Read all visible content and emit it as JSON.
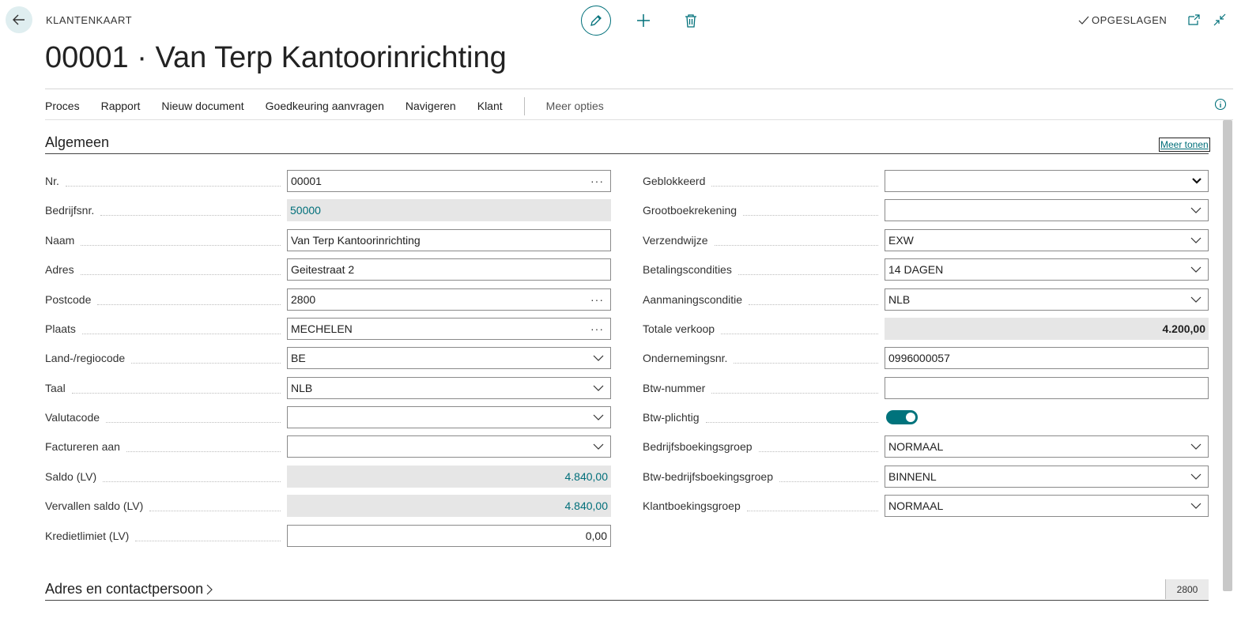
{
  "header": {
    "page_type": "KLANTENKAART",
    "title": "00001 · Van Terp Kantoorinrichting",
    "saved_status": "OPGESLAGEN"
  },
  "actionbar": {
    "items": [
      "Proces",
      "Rapport",
      "Nieuw document",
      "Goedkeuring aanvragen",
      "Navigeren",
      "Klant"
    ],
    "more": "Meer opties"
  },
  "section_general": {
    "title": "Algemeen",
    "show_more": "Meer tonen"
  },
  "left_fields": [
    {
      "label": "Nr.",
      "value": "00001"
    },
    {
      "label": "Bedrijfsnr.",
      "value": "50000"
    },
    {
      "label": "Naam",
      "value": "Van Terp Kantoorinrichting"
    },
    {
      "label": "Adres",
      "value": "Geitestraat 2"
    },
    {
      "label": "Postcode",
      "value": "2800"
    },
    {
      "label": "Plaats",
      "value": "MECHELEN"
    },
    {
      "label": "Land-/regiocode",
      "value": "BE"
    },
    {
      "label": "Taal",
      "value": "NLB"
    },
    {
      "label": "Valutacode",
      "value": ""
    },
    {
      "label": "Factureren aan",
      "value": ""
    },
    {
      "label": "Saldo (LV)",
      "value": "4.840,00"
    },
    {
      "label": "Vervallen saldo (LV)",
      "value": "4.840,00"
    },
    {
      "label": "Kredietlimiet (LV)",
      "value": "0,00"
    }
  ],
  "right_fields": [
    {
      "label": "Geblokkeerd",
      "value": ""
    },
    {
      "label": "Grootboekrekening",
      "value": ""
    },
    {
      "label": "Verzendwijze",
      "value": "EXW"
    },
    {
      "label": "Betalingscondities",
      "value": "14 DAGEN"
    },
    {
      "label": "Aanmaningsconditie",
      "value": "NLB"
    },
    {
      "label": "Totale verkoop",
      "value": "4.200,00"
    },
    {
      "label": "Ondernemingsnr.",
      "value": "0996000057"
    },
    {
      "label": "Btw-nummer",
      "value": ""
    },
    {
      "label": "Btw-plichtig",
      "value": true
    },
    {
      "label": "Bedrijfsboekingsgroep",
      "value": "NORMAAL"
    },
    {
      "label": "Btw-bedrijfsboekingsgroep",
      "value": "BINNENL"
    },
    {
      "label": "Klantboekingsgroep",
      "value": "NORMAAL"
    }
  ],
  "section_address": {
    "title": "Adres en contactpersoon",
    "badge": "2800"
  },
  "colors": {
    "accent": "#00707a",
    "readonly_bg": "#e6e6e6",
    "toggle_on": "#00737c"
  },
  "icons": [
    "back-arrow-icon",
    "pencil-icon",
    "plus-icon",
    "trash-icon",
    "checkmark-icon",
    "open-in-new-window-icon",
    "collapse-icon",
    "info-icon",
    "chevron-down-icon",
    "chevron-right-icon"
  ]
}
